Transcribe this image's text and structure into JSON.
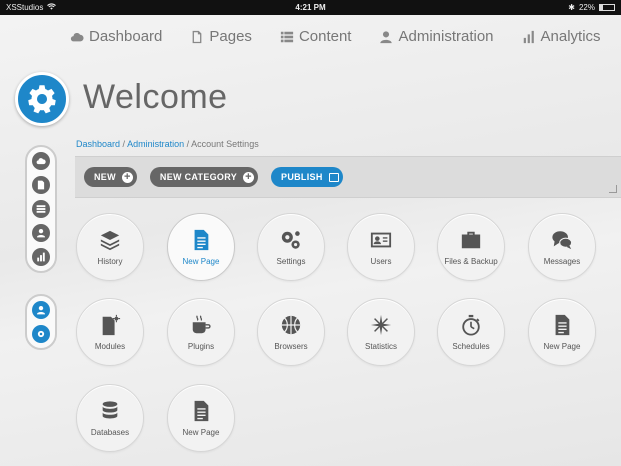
{
  "status_bar": {
    "carrier": "XSStudios",
    "time": "4:21 PM",
    "battery": "22%"
  },
  "topnav": [
    {
      "label": "Dashboard",
      "icon": "cloud-icon"
    },
    {
      "label": "Pages",
      "icon": "page-icon"
    },
    {
      "label": "Content",
      "icon": "list-icon"
    },
    {
      "label": "Administration",
      "icon": "user-icon"
    },
    {
      "label": "Analytics",
      "icon": "chart-icon"
    }
  ],
  "page": {
    "title": "Welcome"
  },
  "breadcrumb": {
    "items": [
      "Dashboard",
      "Administration"
    ],
    "current": "Account Settings",
    "separator": "/"
  },
  "toolbar": {
    "new_label": "NEW",
    "new_category_label": "NEW CATEGORY",
    "publish_label": "PUBLISH"
  },
  "tiles": [
    {
      "label": "History",
      "icon": "layers-icon"
    },
    {
      "label": "New Page",
      "icon": "document-icon",
      "active": true
    },
    {
      "label": "Settings",
      "icon": "gears-icon"
    },
    {
      "label": "Users",
      "icon": "id-card-icon"
    },
    {
      "label": "Files & Backup",
      "icon": "briefcase-icon"
    },
    {
      "label": "Messages",
      "icon": "chat-bubbles-icon"
    },
    {
      "label": "Modules",
      "icon": "module-icon"
    },
    {
      "label": "Plugins",
      "icon": "mug-icon"
    },
    {
      "label": "Browsers",
      "icon": "basketball-icon"
    },
    {
      "label": "Statistics",
      "icon": "compass-star-icon"
    },
    {
      "label": "Schedules",
      "icon": "stopwatch-icon"
    },
    {
      "label": "New Page",
      "icon": "document-icon"
    },
    {
      "label": "Databases",
      "icon": "database-icon"
    },
    {
      "label": "New Page",
      "icon": "document-icon"
    }
  ],
  "colors": {
    "accent": "#1e87c9",
    "button_dark": "#666666",
    "toolbar_bg": "#dcdcdc"
  }
}
